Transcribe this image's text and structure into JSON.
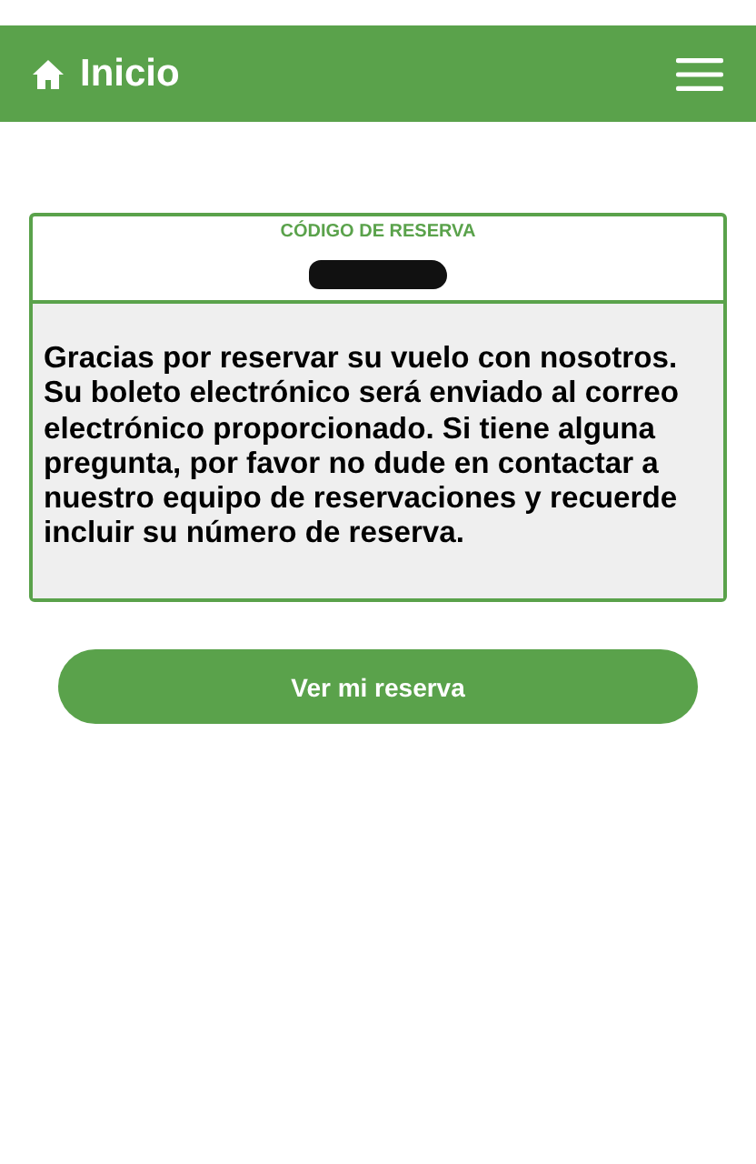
{
  "header": {
    "title": "Inicio"
  },
  "booking": {
    "code_label": "CÓDIGO DE RESERVA",
    "code_redacted": true,
    "message": "Gracias por reservar su vuelo con nosotros. Su boleto electrónico será enviado al correo electrónico proporcionado. Si tiene alguna pregunta, por favor no dude en contactar a nuestro equipo de reservaciones y recuerde incluir su número de reserva."
  },
  "buttons": [
    "Ver mi reserva"
  ]
}
